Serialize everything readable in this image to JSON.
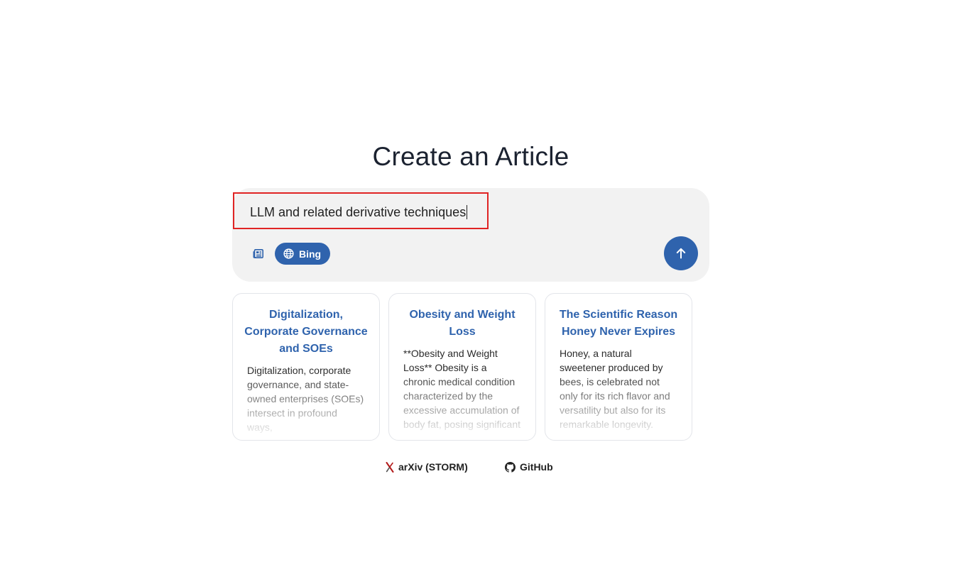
{
  "page": {
    "title": "Create an Article"
  },
  "composer": {
    "query_value": "LLM and related derivative techniques",
    "news_icon": "newspaper-icon",
    "search_engine": {
      "label": "Bing",
      "icon": "globe-icon",
      "active_color": "#2f63ad"
    },
    "submit_icon": "arrow-up-icon"
  },
  "cards": [
    {
      "title": "Digitalization, Corporate Governance and SOEs",
      "snippet": "Digitalization, corporate governance, and state-owned enterprises (SOEs) intersect in profound ways,"
    },
    {
      "title": "Obesity and Weight Loss",
      "snippet": "**Obesity and Weight Loss** Obesity is a chronic medical condition characterized by the excessive accumulation of body fat, posing significant risks to"
    },
    {
      "title": "The Scientific Reason Honey Never Expires",
      "snippet": "Honey, a natural sweetener produced by bees, is celebrated not only for its rich flavor and versatility but also for its remarkable longevity. Renowned for its ability"
    }
  ],
  "footer": {
    "arxiv_label": "arXiv (STORM)",
    "arxiv_icon": "arxiv-icon",
    "github_label": "GitHub",
    "github_icon": "github-icon"
  },
  "colors": {
    "accent": "#2f63ad",
    "highlight_border": "#e02424",
    "composer_bg": "#f2f2f2"
  }
}
